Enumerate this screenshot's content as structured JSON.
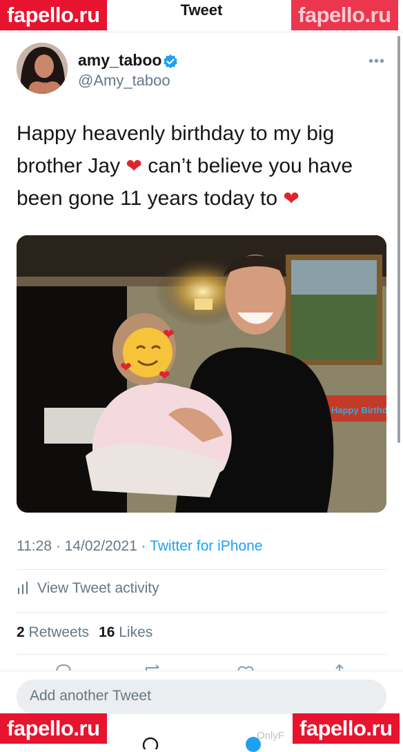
{
  "header": {
    "title": "Tweet"
  },
  "watermarks": {
    "top_left": "fapello.ru",
    "top_right": "fapello.ru",
    "bottom_left": "fapello.ru",
    "bottom_right": "fapello.ru",
    "overlay": "OnlyF"
  },
  "author": {
    "display_name": "amy_taboo",
    "handle": "@Amy_taboo",
    "verified": true
  },
  "tweet": {
    "text_part_1": "Happy heavenly birthday to my big brother Jay ",
    "text_part_2": " can’t believe you have been gone 11 years today to ",
    "heart_icon": "red-heart-icon"
  },
  "photo": {
    "banner_text": "Happy Birthday"
  },
  "meta": {
    "time": "11:28",
    "date": "14/02/2021",
    "separator": " · ",
    "source": "Twitter for iPhone"
  },
  "activity": {
    "label": "View Tweet activity"
  },
  "stats": {
    "retweets_count": "2",
    "retweets_label": " Retweets",
    "likes_count": "16",
    "likes_label": " Likes"
  },
  "reply": {
    "placeholder": "Add another Tweet"
  },
  "colors": {
    "accent": "#1da1f2",
    "heart": "#e0242b",
    "watermark": "#e8132e",
    "secondary_text": "#657786"
  }
}
